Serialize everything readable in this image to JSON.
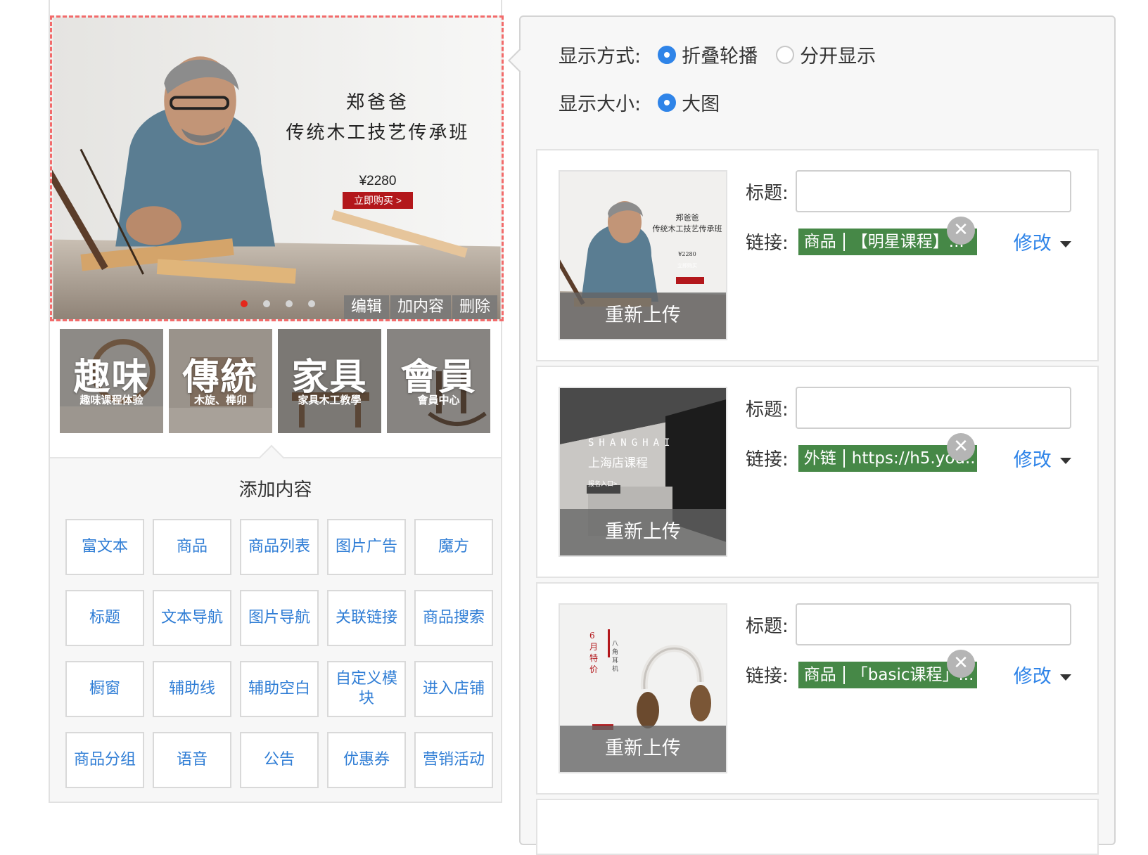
{
  "banner": {
    "line1": "郑爸爸",
    "line2": "传统木工技艺传承班",
    "price": "¥2280",
    "buy_label": "立即购买 >",
    "actions": [
      "编辑",
      "加内容",
      "删除"
    ],
    "dots": 4,
    "active_dot": 0
  },
  "categories": [
    {
      "big": "趣味",
      "small": "趣味课程体验"
    },
    {
      "big": "傳統",
      "small": "木旋、榫卯"
    },
    {
      "big": "家具",
      "small": "家具木工教學"
    },
    {
      "big": "會員",
      "small": "會員中心"
    }
  ],
  "add_panel": {
    "title": "添加内容",
    "buttons": [
      "富文本",
      "商品",
      "商品列表",
      "图片广告",
      "魔方",
      "标题",
      "文本导航",
      "图片导航",
      "关联链接",
      "商品搜索",
      "橱窗",
      "辅助线",
      "辅助空白",
      "自定义模块",
      "进入店铺",
      "商品分组",
      "语音",
      "公告",
      "优惠券",
      "营销活动"
    ]
  },
  "settings": {
    "display_mode_label": "显示方式:",
    "display_mode_options": [
      "折叠轮播",
      "分开显示"
    ],
    "display_mode_selected": "折叠轮播",
    "display_size_label": "显示大小:",
    "display_size_options": [
      "大图"
    ],
    "display_size_selected": "大图"
  },
  "items": [
    {
      "reupload": "重新上传",
      "title_label": "标题:",
      "title_value": "",
      "link_label": "链接:",
      "link_type": "商品",
      "link_text": "【明星课程】...",
      "modify": "修改",
      "thumb_text1": "郑爸爸",
      "thumb_text2": "传统木工技艺传承班",
      "thumb_price": "¥2280",
      "thumb_buy": "立即购买"
    },
    {
      "reupload": "重新上传",
      "title_label": "标题:",
      "title_value": "",
      "link_label": "链接:",
      "link_type": "外链",
      "link_text": "https://h5.you...",
      "modify": "修改",
      "thumb_text1": "SHANGHAI",
      "thumb_text2": "上海店课程",
      "thumb_buy": "报名入口>"
    },
    {
      "reupload": "重新上传",
      "title_label": "标题:",
      "title_value": "",
      "link_label": "链接:",
      "link_type": "商品",
      "link_text": "「basic课程」...",
      "modify": "修改",
      "thumb_text1": "6月特价",
      "thumb_text2": "八角耳机"
    }
  ],
  "icons": {
    "close": "close-icon",
    "dropdown": "caret-down-icon"
  },
  "colors": {
    "accent": "#2f84e8",
    "tag_green": "#468847",
    "dash_red": "#f26b6b",
    "link_blue": "#2f7dd5"
  }
}
